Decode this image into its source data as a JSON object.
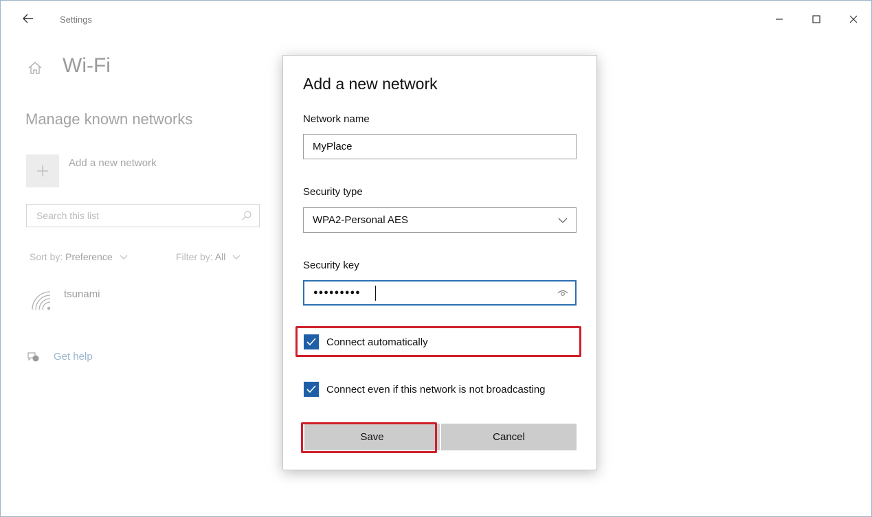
{
  "window": {
    "app_title": "Settings"
  },
  "left_pane": {
    "page_title": "Wi-Fi",
    "section_title": "Manage known networks",
    "add_network_label": "Add a new network",
    "search_placeholder": "Search this list",
    "sort_label": "Sort by:",
    "sort_value": "Preference",
    "filter_label": "Filter by:",
    "filter_value": "All",
    "networks": [
      {
        "name": "tsunami"
      }
    ],
    "help_link": "Get help"
  },
  "dialog": {
    "title": "Add a new network",
    "network_name_label": "Network name",
    "network_name_value": "MyPlace",
    "security_type_label": "Security type",
    "security_type_value": "WPA2-Personal AES",
    "security_key_label": "Security key",
    "security_key_masked": "●●●●●●●●●",
    "connect_automatically_label": "Connect automatically",
    "connect_automatically_checked": true,
    "connect_hidden_label": "Connect even if this network is not broadcasting",
    "connect_hidden_checked": true,
    "save_label": "Save",
    "cancel_label": "Cancel"
  },
  "colors": {
    "accent": "#1f5fa7",
    "focus_border": "#2c6fb3",
    "highlight": "#d0202a",
    "button_bg": "#cccccc"
  }
}
